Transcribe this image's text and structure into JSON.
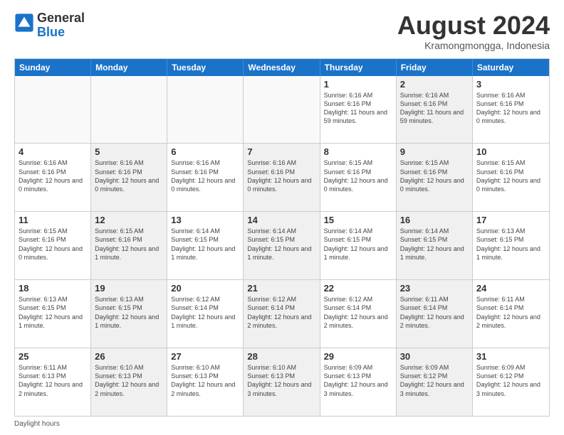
{
  "header": {
    "logo_general": "General",
    "logo_blue": "Blue",
    "month_title": "August 2024",
    "subtitle": "Kramongmongga, Indonesia"
  },
  "days_of_week": [
    "Sunday",
    "Monday",
    "Tuesday",
    "Wednesday",
    "Thursday",
    "Friday",
    "Saturday"
  ],
  "footer": {
    "note": "Daylight hours"
  },
  "weeks": [
    [
      {
        "day": "",
        "info": "",
        "empty": true
      },
      {
        "day": "",
        "info": "",
        "empty": true
      },
      {
        "day": "",
        "info": "",
        "empty": true
      },
      {
        "day": "",
        "info": "",
        "empty": true
      },
      {
        "day": "1",
        "info": "Sunrise: 6:16 AM\nSunset: 6:16 PM\nDaylight: 11 hours\nand 59 minutes.",
        "empty": false
      },
      {
        "day": "2",
        "info": "Sunrise: 6:16 AM\nSunset: 6:16 PM\nDaylight: 11 hours\nand 59 minutes.",
        "empty": false,
        "shaded": true
      },
      {
        "day": "3",
        "info": "Sunrise: 6:16 AM\nSunset: 6:16 PM\nDaylight: 12 hours\nand 0 minutes.",
        "empty": false
      }
    ],
    [
      {
        "day": "4",
        "info": "Sunrise: 6:16 AM\nSunset: 6:16 PM\nDaylight: 12 hours\nand 0 minutes.",
        "empty": false
      },
      {
        "day": "5",
        "info": "Sunrise: 6:16 AM\nSunset: 6:16 PM\nDaylight: 12 hours\nand 0 minutes.",
        "empty": false,
        "shaded": true
      },
      {
        "day": "6",
        "info": "Sunrise: 6:16 AM\nSunset: 6:16 PM\nDaylight: 12 hours\nand 0 minutes.",
        "empty": false
      },
      {
        "day": "7",
        "info": "Sunrise: 6:16 AM\nSunset: 6:16 PM\nDaylight: 12 hours\nand 0 minutes.",
        "empty": false,
        "shaded": true
      },
      {
        "day": "8",
        "info": "Sunrise: 6:15 AM\nSunset: 6:16 PM\nDaylight: 12 hours\nand 0 minutes.",
        "empty": false
      },
      {
        "day": "9",
        "info": "Sunrise: 6:15 AM\nSunset: 6:16 PM\nDaylight: 12 hours\nand 0 minutes.",
        "empty": false,
        "shaded": true
      },
      {
        "day": "10",
        "info": "Sunrise: 6:15 AM\nSunset: 6:16 PM\nDaylight: 12 hours\nand 0 minutes.",
        "empty": false
      }
    ],
    [
      {
        "day": "11",
        "info": "Sunrise: 6:15 AM\nSunset: 6:16 PM\nDaylight: 12 hours\nand 0 minutes.",
        "empty": false
      },
      {
        "day": "12",
        "info": "Sunrise: 6:15 AM\nSunset: 6:16 PM\nDaylight: 12 hours\nand 1 minute.",
        "empty": false,
        "shaded": true
      },
      {
        "day": "13",
        "info": "Sunrise: 6:14 AM\nSunset: 6:15 PM\nDaylight: 12 hours\nand 1 minute.",
        "empty": false
      },
      {
        "day": "14",
        "info": "Sunrise: 6:14 AM\nSunset: 6:15 PM\nDaylight: 12 hours\nand 1 minute.",
        "empty": false,
        "shaded": true
      },
      {
        "day": "15",
        "info": "Sunrise: 6:14 AM\nSunset: 6:15 PM\nDaylight: 12 hours\nand 1 minute.",
        "empty": false
      },
      {
        "day": "16",
        "info": "Sunrise: 6:14 AM\nSunset: 6:15 PM\nDaylight: 12 hours\nand 1 minute.",
        "empty": false,
        "shaded": true
      },
      {
        "day": "17",
        "info": "Sunrise: 6:13 AM\nSunset: 6:15 PM\nDaylight: 12 hours\nand 1 minute.",
        "empty": false
      }
    ],
    [
      {
        "day": "18",
        "info": "Sunrise: 6:13 AM\nSunset: 6:15 PM\nDaylight: 12 hours\nand 1 minute.",
        "empty": false
      },
      {
        "day": "19",
        "info": "Sunrise: 6:13 AM\nSunset: 6:15 PM\nDaylight: 12 hours\nand 1 minute.",
        "empty": false,
        "shaded": true
      },
      {
        "day": "20",
        "info": "Sunrise: 6:12 AM\nSunset: 6:14 PM\nDaylight: 12 hours\nand 1 minute.",
        "empty": false
      },
      {
        "day": "21",
        "info": "Sunrise: 6:12 AM\nSunset: 6:14 PM\nDaylight: 12 hours\nand 2 minutes.",
        "empty": false,
        "shaded": true
      },
      {
        "day": "22",
        "info": "Sunrise: 6:12 AM\nSunset: 6:14 PM\nDaylight: 12 hours\nand 2 minutes.",
        "empty": false
      },
      {
        "day": "23",
        "info": "Sunrise: 6:11 AM\nSunset: 6:14 PM\nDaylight: 12 hours\nand 2 minutes.",
        "empty": false,
        "shaded": true
      },
      {
        "day": "24",
        "info": "Sunrise: 6:11 AM\nSunset: 6:14 PM\nDaylight: 12 hours\nand 2 minutes.",
        "empty": false
      }
    ],
    [
      {
        "day": "25",
        "info": "Sunrise: 6:11 AM\nSunset: 6:13 PM\nDaylight: 12 hours\nand 2 minutes.",
        "empty": false
      },
      {
        "day": "26",
        "info": "Sunrise: 6:10 AM\nSunset: 6:13 PM\nDaylight: 12 hours\nand 2 minutes.",
        "empty": false,
        "shaded": true
      },
      {
        "day": "27",
        "info": "Sunrise: 6:10 AM\nSunset: 6:13 PM\nDaylight: 12 hours\nand 2 minutes.",
        "empty": false
      },
      {
        "day": "28",
        "info": "Sunrise: 6:10 AM\nSunset: 6:13 PM\nDaylight: 12 hours\nand 3 minutes.",
        "empty": false,
        "shaded": true
      },
      {
        "day": "29",
        "info": "Sunrise: 6:09 AM\nSunset: 6:13 PM\nDaylight: 12 hours\nand 3 minutes.",
        "empty": false
      },
      {
        "day": "30",
        "info": "Sunrise: 6:09 AM\nSunset: 6:12 PM\nDaylight: 12 hours\nand 3 minutes.",
        "empty": false,
        "shaded": true
      },
      {
        "day": "31",
        "info": "Sunrise: 6:09 AM\nSunset: 6:12 PM\nDaylight: 12 hours\nand 3 minutes.",
        "empty": false
      }
    ]
  ]
}
